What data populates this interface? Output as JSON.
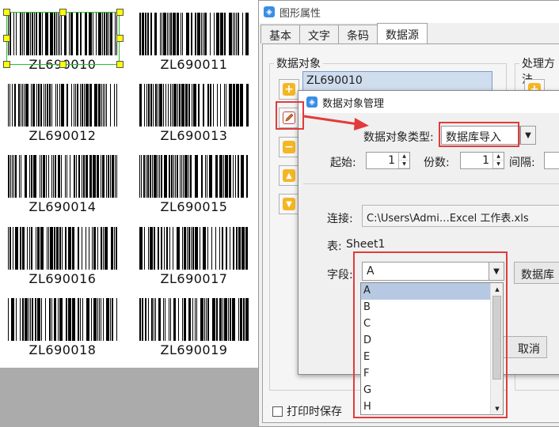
{
  "canvas": {
    "barcodes": [
      "ZL690010",
      "ZL690011",
      "ZL690012",
      "ZL690013",
      "ZL690014",
      "ZL690015",
      "ZL690016",
      "ZL690017",
      "ZL690018",
      "ZL690019"
    ]
  },
  "prop_window": {
    "title": "图形属性",
    "tabs": [
      "基本",
      "文字",
      "条码",
      "数据源"
    ],
    "active_tab": "数据源",
    "data_objects_label": "数据对象",
    "data_objects": [
      "ZL690010"
    ],
    "process_label": "处理方法",
    "print_save_label": "打印时保存"
  },
  "dialog": {
    "title": "数据对象管理",
    "type_label": "数据对象类型:",
    "type_value": "数据库导入",
    "start_label": "起始:",
    "start_value": "1",
    "copies_label": "份数:",
    "copies_value": "1",
    "interval_label": "间隔:",
    "connection_label": "连接:",
    "connection_value": "C:\\Users\\Admi…Excel 工作表.xls",
    "table_label": "表:",
    "table_value": "Sheet1",
    "field_label": "字段:",
    "field_value": "A",
    "db_button": "数据库",
    "cancel_button": "取消"
  },
  "field_options": [
    "A",
    "B",
    "C",
    "D",
    "E",
    "F",
    "G",
    "H"
  ],
  "selected_field": "A",
  "colors": {
    "highlight": "#e23b3b",
    "selection_green": "#2ac12a",
    "handle_yellow": "#ffff00",
    "list_selected": "#b7c9e2"
  }
}
